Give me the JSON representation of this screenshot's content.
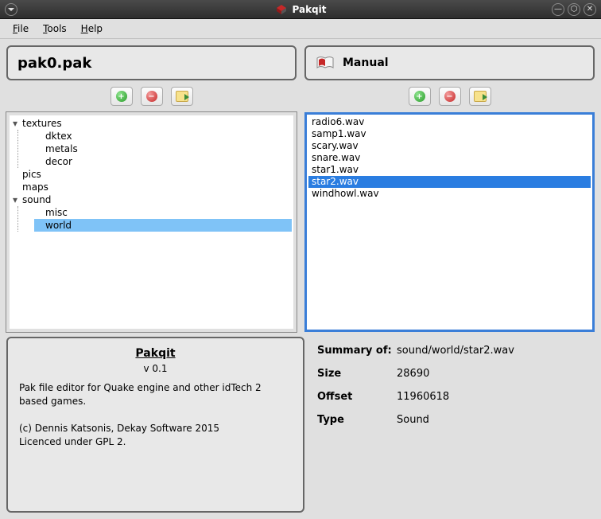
{
  "window": {
    "title": "Pakqit"
  },
  "menu": {
    "file": "File",
    "tools": "Tools",
    "help": "Help"
  },
  "left": {
    "header": "pak0.pak",
    "tree": {
      "textures": {
        "label": "textures",
        "children": [
          "dktex",
          "metals",
          "decor"
        ]
      },
      "pics": "pics",
      "maps": "maps",
      "sound": {
        "label": "sound",
        "children": [
          "misc",
          "world"
        ],
        "selected": "world"
      }
    }
  },
  "right": {
    "header": "Manual",
    "files": [
      "radio6.wav",
      "samp1.wav",
      "scary.wav",
      "snare.wav",
      "star1.wav",
      "star2.wav",
      "windhowl.wav"
    ],
    "selected": "star2.wav"
  },
  "about": {
    "title": "Pakqit",
    "version": "v 0.1",
    "desc": "Pak file editor for Quake engine and other idTech 2 based games.",
    "copyright": "(c) Dennis Katsonis, Dekay Software 2015",
    "license": "Licenced under GPL 2."
  },
  "summary": {
    "heading": "Summary of:",
    "path": "sound/world/star2.wav",
    "size_label": "Size",
    "size": "28690",
    "offset_label": "Offset",
    "offset": "11960618",
    "type_label": "Type",
    "type": "Sound"
  }
}
